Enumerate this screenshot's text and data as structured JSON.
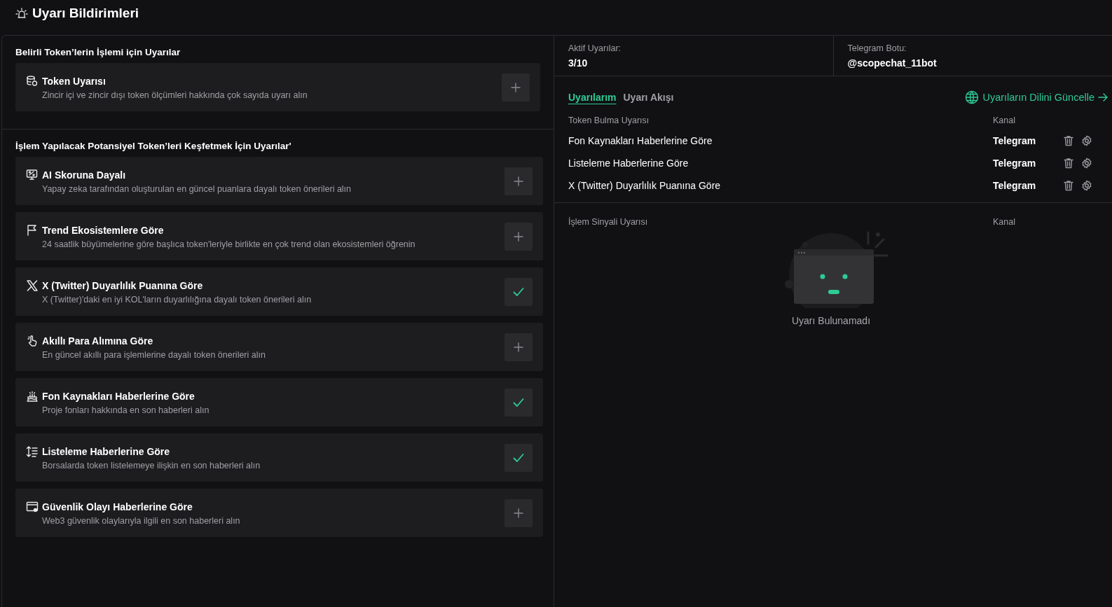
{
  "header": {
    "title": "Uyarı Bildirimleri"
  },
  "token_section": {
    "title": "Belirli Token’lerin İşlemi için Uyarılar",
    "cards": [
      {
        "kind": "coins",
        "title": "Token Uyarısı",
        "description": "Zincir içi ve zincir dışı token ölçümleri hakkında çok sayıda uyarı alın",
        "subscribed": false
      }
    ]
  },
  "discover_section": {
    "title": "İşlem Yapılacak Potansiyel Token’leri Keşfetmek İçin Uyarılar'",
    "cards": [
      {
        "kind": "monitor",
        "title": "AI Skoruna Dayalı",
        "description": "Yapay zeka tarafından oluşturulan en güncel puanlara dayalı token önerileri alın",
        "subscribed": false
      },
      {
        "kind": "flag",
        "title": "Trend Ekosistemlere Göre",
        "description": "24 saatlik büyümelerine göre başlıca token'leriyle birlikte en çok trend olan ekosistemleri öğrenin",
        "subscribed": false
      },
      {
        "kind": "x",
        "title": "X (Twitter) Duyarlılık Puanına Göre",
        "description": "X (Twitter)'daki en iyi KOL'ların duyarlılığına dayalı token önerileri alın",
        "subscribed": true
      },
      {
        "kind": "hand",
        "title": "Akıllı Para Alımına Göre",
        "description": "En güncel akıllı para işlemlerine dayalı token önerileri alın",
        "subscribed": false
      },
      {
        "kind": "fund",
        "title": "Fon Kaynakları Haberlerine Göre",
        "description": "Proje fonları hakkında en son haberleri alın",
        "subscribed": true
      },
      {
        "kind": "list",
        "title": "Listeleme Haberlerine Göre",
        "description": "Borsalarda token listelemeye ilişkin en son haberleri alın",
        "subscribed": true
      },
      {
        "kind": "shield",
        "title": "Güvenlik Olayı Haberlerine Göre",
        "description": "Web3 güvenlik olaylarıyla ilgili en son haberleri alın",
        "subscribed": false
      }
    ]
  },
  "stats": [
    {
      "label": "Aktif Uyarılar:",
      "value": "3/10"
    },
    {
      "label": "Telegram Botu:",
      "value": "@scopechat_11bot"
    }
  ],
  "tabs": [
    {
      "label": "Uyarılarım",
      "selected": true
    },
    {
      "label": "Uyarı Akışı",
      "selected": false
    }
  ],
  "language_link": "Uyarıların Dilini Güncelle",
  "token_table": {
    "columns": [
      "Token Bulma Uyarısı",
      "Kanal"
    ],
    "rows": [
      {
        "name": "Fon Kaynakları Haberlerine Göre",
        "channel": "Telegram"
      },
      {
        "name": "Listeleme Haberlerine Göre",
        "channel": "Telegram"
      },
      {
        "name": "X (Twitter) Duyarlılık Puanına Göre",
        "channel": "Telegram"
      }
    ]
  },
  "signal_table": {
    "columns": [
      "İşlem Sinyali Uyarısı",
      "Kanal"
    ],
    "empty_text": "Uyarı Bulunamadı"
  }
}
